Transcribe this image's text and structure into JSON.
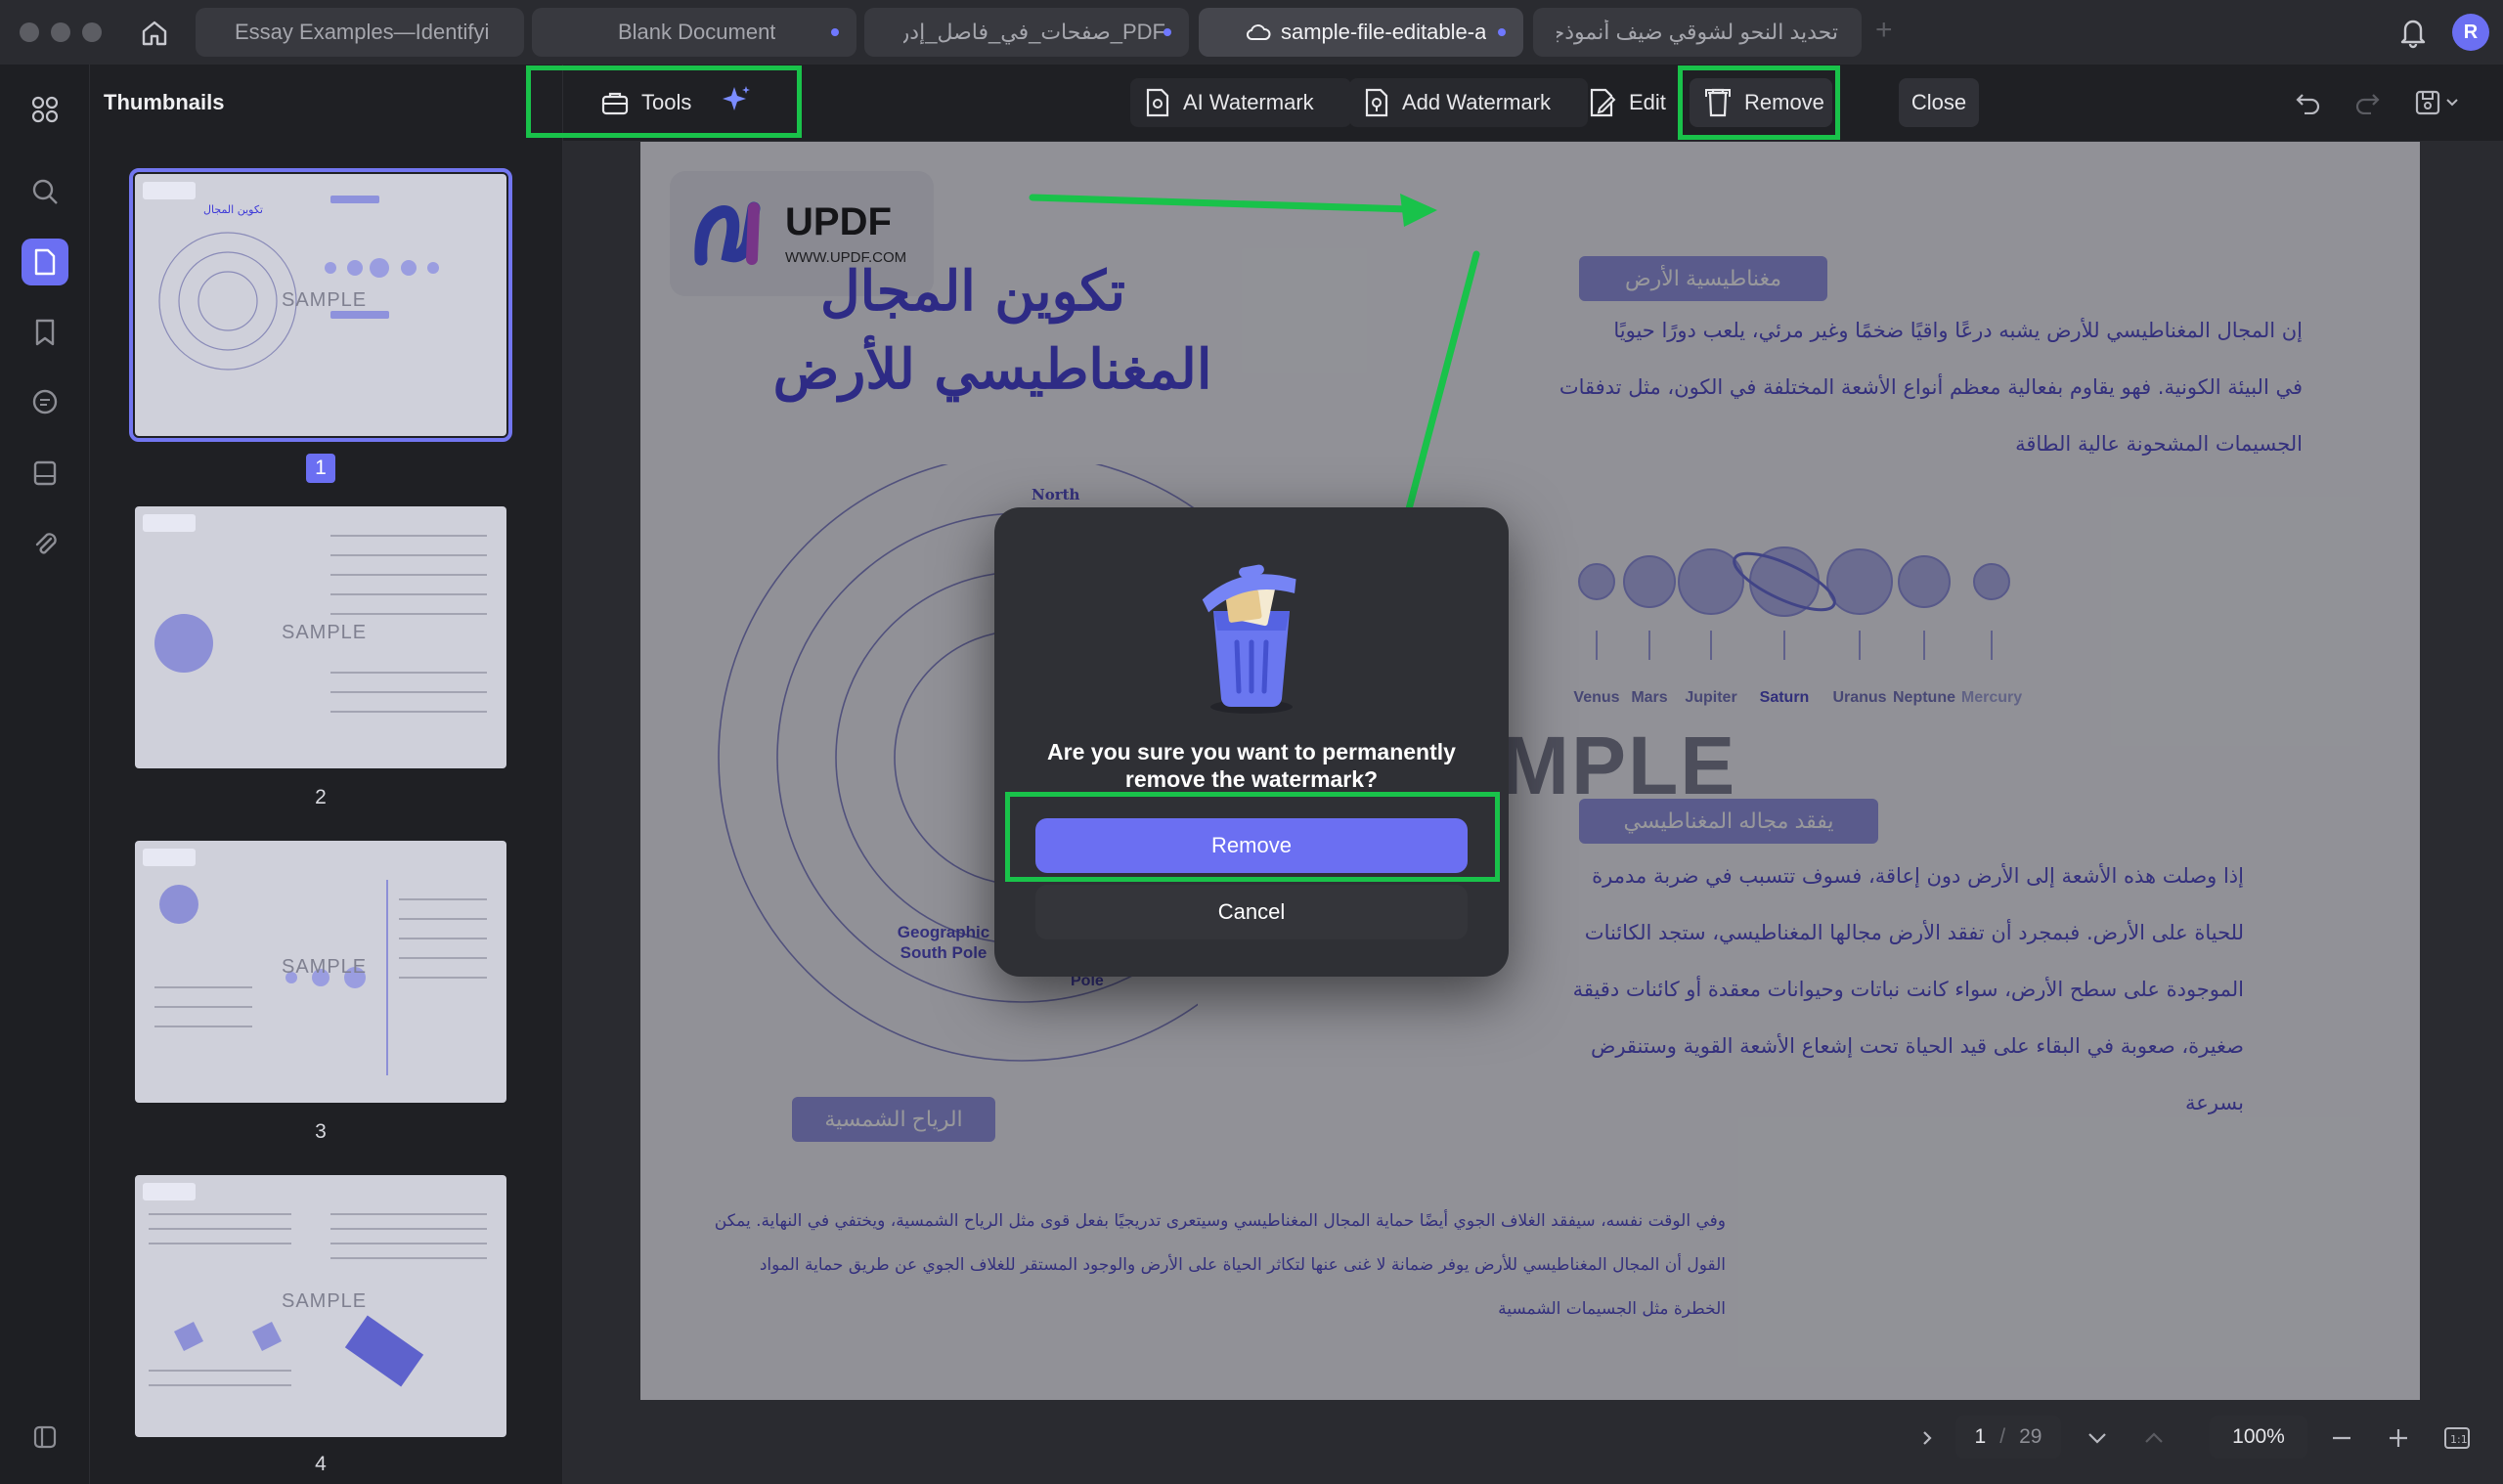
{
  "tabs": [
    {
      "label": "Essay Examples—Identifyi",
      "has_dot": false,
      "active": false
    },
    {
      "label": "Blank Document",
      "has_dot": true,
      "active": false
    },
    {
      "label": "PDF_صفحات_في_فاصل_إدراج",
      "has_dot": true,
      "active": false
    },
    {
      "label": "sample-file-editable-a",
      "has_dot": true,
      "active": true
    },
    {
      "label": "تحديد النحو لشوقي ضيف أنموذجا",
      "has_dot": false,
      "active": false
    }
  ],
  "user": {
    "avatar_initial": "R"
  },
  "sidebar": {
    "title": "Thumbnails"
  },
  "thumbnails": {
    "page_numbers": [
      "1",
      "2",
      "3",
      "4"
    ],
    "watermark": "SAMPLE"
  },
  "toolbar": {
    "tools_label": "Tools",
    "ai_watermark_label": "AI Watermark",
    "add_watermark_label": "Add Watermark",
    "edit_label": "Edit",
    "remove_label": "Remove",
    "close_label": "Close"
  },
  "document": {
    "logo_brand": "UPDF",
    "logo_url": "WWW.UPDF.COM",
    "title_line1": "تكوين المجال",
    "title_line2": "المغناطيسي للأرض",
    "section1_pill": "مغناطيسية الأرض",
    "section1_lines": [
      "إن المجال المغناطيسي للأرض يشبه درعًا واقيًا ضخمًا وغير مرئي، يلعب دورًا حيويًا",
      "في البيئة الكونية. فهو يقاوم بفعالية معظم أنواع الأشعة المختلفة في الكون، مثل تدفقات",
      "الجسيمات المشحونة عالية الطاقة"
    ],
    "section2_pill": "يفقد مجاله المغناطيسي",
    "section2_lines": [
      "إذا وصلت هذه الأشعة إلى الأرض دون إعاقة، فسوف تتسبب في ضربة مدمرة",
      "للحياة على الأرض. فبمجرد أن تفقد الأرض مجالها المغناطيسي، ستجد الكائنات",
      "الموجودة على سطح الأرض، سواء كانت نباتات وحيوانات معقدة أو كائنات دقيقة",
      "صغيرة، صعوبة في البقاء على قيد الحياة تحت إشعاع الأشعة القوية وستنقرض",
      "بسرعة"
    ],
    "section3_pill": "الرياح الشمسية",
    "section3_lines": [
      "وفي الوقت نفسه، سيفقد الغلاف الجوي أيضًا حماية المجال المغناطيسي وسيتعرى تدريجيًا بفعل قوى مثل الرياح الشمسية، ويختفي في النهاية. يمكن",
      "القول أن المجال المغناطيسي للأرض يوفر ضمانة لا غنى عنها لتكاثر الحياة على الأرض والوجود المستقر للغلاف الجوي عن طريق حماية المواد",
      "الخطرة مثل الجسيمات الشمسية"
    ],
    "diagram_labels": {
      "north": "North",
      "south_pole": "Geographic\nSouth Pole",
      "pole": "Pole"
    },
    "planets": [
      "Venus",
      "Mars",
      "Jupiter",
      "Saturn",
      "Uranus",
      "Neptune",
      "Mercury"
    ],
    "watermark_text": "MPLE"
  },
  "dialog": {
    "question": "Are you sure you want to permanently remove the watermark?",
    "confirm_label": "Remove",
    "cancel_label": "Cancel"
  },
  "pager": {
    "current_page": "1",
    "separator": "/",
    "total_pages": "29",
    "zoom": "100%"
  },
  "colors": {
    "accent": "#6b6ff2",
    "highlight_green": "#19c24a",
    "doc_text": "#4943c8"
  }
}
